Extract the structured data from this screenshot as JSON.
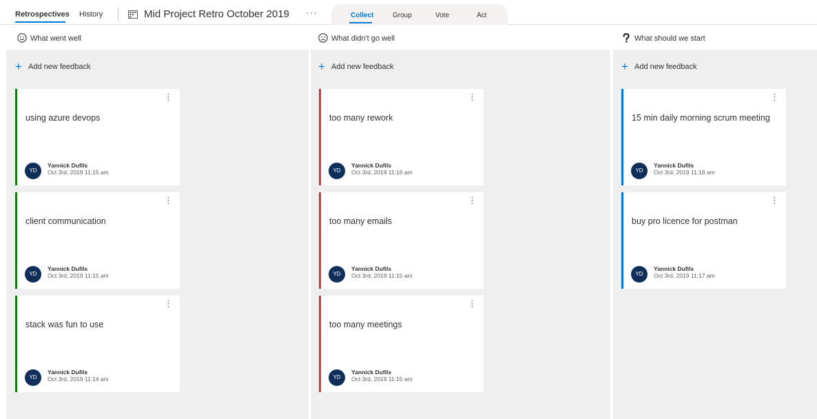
{
  "nav": {
    "tabs": [
      {
        "label": "Retrospectives",
        "active": true
      },
      {
        "label": "History",
        "active": false
      }
    ],
    "board_title": "Mid Project Retro October 2019",
    "board_icon": "board-icon",
    "more_label": "···"
  },
  "phases": [
    {
      "label": "Collect",
      "active": true
    },
    {
      "label": "Group",
      "active": false
    },
    {
      "label": "Vote",
      "active": false
    },
    {
      "label": "Act",
      "active": false
    }
  ],
  "add_feedback_label": "Add new feedback",
  "colors": {
    "accent": "#0078d4",
    "went_well": "#107c10",
    "didnt_go_well": "#d13438",
    "should_start": "#0078d4",
    "avatar": "#0f2e5a"
  },
  "columns": [
    {
      "title": "What went well",
      "icon": "smile-icon",
      "cards": [
        {
          "text": "using azure devops",
          "initials": "YD",
          "author": "Yannick Dufils",
          "timestamp": "Oct 3rd, 2019 11:15 am"
        },
        {
          "text": "client communication",
          "initials": "YD",
          "author": "Yannick Dufils",
          "timestamp": "Oct 3rd, 2019 11:15 am"
        },
        {
          "text": "stack was fun to use",
          "initials": "YD",
          "author": "Yannick Dufils",
          "timestamp": "Oct 3rd, 2019 11:14 am"
        }
      ]
    },
    {
      "title": "What didn't go well",
      "icon": "frown-icon",
      "cards": [
        {
          "text": "too many rework",
          "initials": "YD",
          "author": "Yannick Dufils",
          "timestamp": "Oct 3rd, 2019 11:16 am"
        },
        {
          "text": "too many emails",
          "initials": "YD",
          "author": "Yannick Dufils",
          "timestamp": "Oct 3rd, 2019 11:15 am"
        },
        {
          "text": "too many meetings",
          "initials": "YD",
          "author": "Yannick Dufils",
          "timestamp": "Oct 3rd, 2019 11:15 am"
        }
      ]
    },
    {
      "title": "What should we start",
      "icon": "question-icon",
      "cards": [
        {
          "text": "15 min daily morning scrum meeting",
          "initials": "YD",
          "author": "Yannick Dufils",
          "timestamp": "Oct 3rd, 2019 11:18 am"
        },
        {
          "text": "buy pro licence for postman",
          "initials": "YD",
          "author": "Yannick Dufils",
          "timestamp": "Oct 3rd, 2019 11:17 am"
        }
      ]
    }
  ]
}
